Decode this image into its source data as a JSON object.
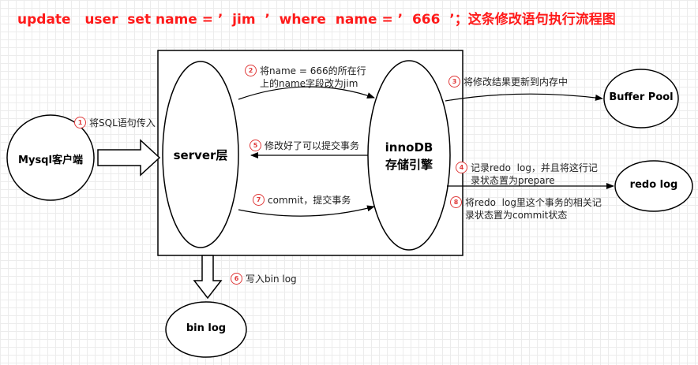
{
  "title": "update   user  set name = ’  jim  ’  where  name = ’  666  ’；这条修改语句执行流程图",
  "nodes": {
    "client": "Mysql客户端",
    "server": "server层",
    "engine_line1": "innoDB",
    "engine_line2": "存储引擎",
    "buffer_pool": "Buffer  Pool",
    "redo_log": "redo  log",
    "bin_log": "bin  log"
  },
  "steps": [
    {
      "num": "1",
      "text": "将SQL语句传入"
    },
    {
      "num": "2",
      "text": "将name = 666的所在行\n上的name字段改为jim"
    },
    {
      "num": "3",
      "text": "将修改结果更新到内存中"
    },
    {
      "num": "4",
      "text": "记录redo  log，并且将这行记\n录状态置为prepare"
    },
    {
      "num": "5",
      "text": "修改好了可以提交事务"
    },
    {
      "num": "6",
      "text": "写入bin log"
    },
    {
      "num": "7",
      "text": "commit，提交事务"
    },
    {
      "num": "8",
      "text": "将redo  log里这个事务的相关记\n录状态置为commit状态"
    }
  ],
  "colors": {
    "title": "#ff1a1a",
    "badge": "#e03a3a",
    "stroke": "#000000"
  }
}
